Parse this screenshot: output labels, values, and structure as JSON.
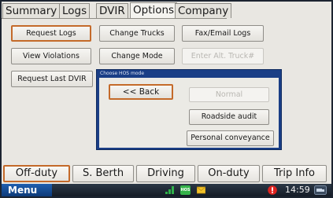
{
  "tabs": [
    {
      "label": "Summary",
      "active": false
    },
    {
      "label": "Logs",
      "active": false
    },
    {
      "label": "DVIR",
      "active": false
    },
    {
      "label": "Options",
      "active": true
    },
    {
      "label": "Company",
      "active": false
    }
  ],
  "options": {
    "request_logs": "Request Logs",
    "change_trucks": "Change Trucks",
    "fax_email_logs": "Fax/Email Logs",
    "view_violations": "View Violations",
    "change_mode": "Change Mode",
    "alt_truck_placeholder": "Enter Alt. Truck#",
    "request_last_dvir": "Request Last DVIR"
  },
  "dialog": {
    "title": "Choose HOS mode",
    "back": "<< Back",
    "normal": "Normal",
    "roadside_audit": "Roadside audit",
    "personal_conveyance": "Personal conveyance"
  },
  "status_buttons": {
    "off_duty": "Off-duty",
    "sleeper_berth": "S. Berth",
    "driving": "Driving",
    "on_duty": "On-duty",
    "trip_info": "Trip Info"
  },
  "taskbar": {
    "menu": "Menu",
    "hos_label": "HOS",
    "time": "14:59"
  },
  "colors": {
    "selected_border": "#c46a2a",
    "dialog_title_bar": "#1a3e86",
    "taskbar": "#1c2430",
    "menu_button": "#1f5fb0"
  }
}
